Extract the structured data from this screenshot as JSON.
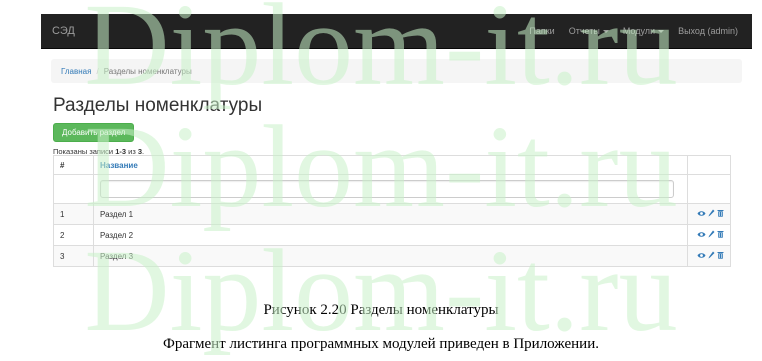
{
  "app": {
    "brand": "СЭД"
  },
  "nav": {
    "items": [
      {
        "label": "Папки",
        "dropdown": false
      },
      {
        "label": "Отчеты",
        "dropdown": true
      },
      {
        "label": "Модули",
        "dropdown": true
      },
      {
        "label": "Выход (admin)",
        "dropdown": false
      }
    ]
  },
  "breadcrumb": {
    "home": "Главная",
    "separator": "/",
    "current": "Разделы номенклатуры"
  },
  "page": {
    "title": "Разделы номенклатуры",
    "add_button": "Добавить раздел",
    "summary_prefix": "Показаны записи ",
    "summary_range": "1-3",
    "summary_mid": " из ",
    "summary_total": "3",
    "summary_end": "."
  },
  "table": {
    "columns": [
      "#",
      "Название"
    ],
    "rows": [
      {
        "num": "1",
        "name": "Раздел 1"
      },
      {
        "num": "2",
        "name": "Раздел 2"
      },
      {
        "num": "3",
        "name": "Раздел 3"
      }
    ],
    "actions": [
      "eye-icon",
      "pencil-icon",
      "trash-icon"
    ]
  },
  "document": {
    "caption": "Рисунок 2.20 Разделы номенклатуры",
    "paragraph": "Фрагмент листинга программных модулей приведен в Приложении."
  },
  "watermark": {
    "text": "Diplom-it.ru",
    "color": "#c9f2c9"
  },
  "colors": {
    "navbar": "#222222",
    "link": "#337ab7",
    "success": "#5cb85c"
  }
}
